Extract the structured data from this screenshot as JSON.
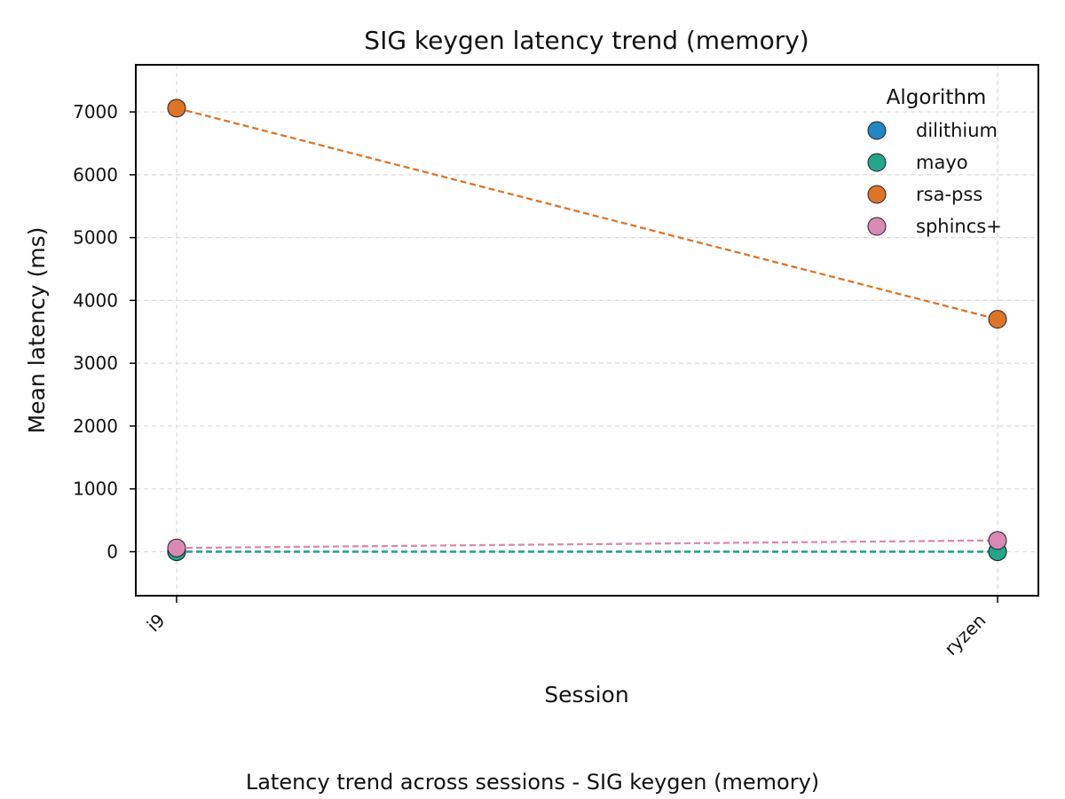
{
  "chart_data": {
    "type": "line",
    "title": "SIG keygen latency trend (memory)",
    "xlabel": "Session",
    "ylabel": "Mean latency (ms)",
    "caption": "Latency trend across sessions - SIG keygen (memory)",
    "categories": [
      "i9",
      "ryzen"
    ],
    "ylim": [
      -700,
      7750
    ],
    "yticks": [
      0,
      1000,
      2000,
      3000,
      4000,
      5000,
      6000,
      7000
    ],
    "ytick_labels": [
      "0",
      "1000",
      "2000",
      "3000",
      "4000",
      "5000",
      "6000",
      "7000"
    ],
    "grid": true,
    "legend": {
      "title": "Algorithm",
      "placement": "top-right"
    },
    "series": [
      {
        "name": "dilithium",
        "values": [
          0.1,
          0.1
        ],
        "color": "#2385c4",
        "line_style": "dashed"
      },
      {
        "name": "mayo",
        "values": [
          0.2,
          0.2
        ],
        "color": "#23a58a",
        "line_style": "dashed"
      },
      {
        "name": "rsa-pss",
        "values": [
          7060,
          3700
        ],
        "color": "#dd7427",
        "line_style": "dashed"
      },
      {
        "name": "sphincs+",
        "values": [
          60,
          180
        ],
        "color": "#d88ab5",
        "line_style": "dashed"
      }
    ]
  }
}
